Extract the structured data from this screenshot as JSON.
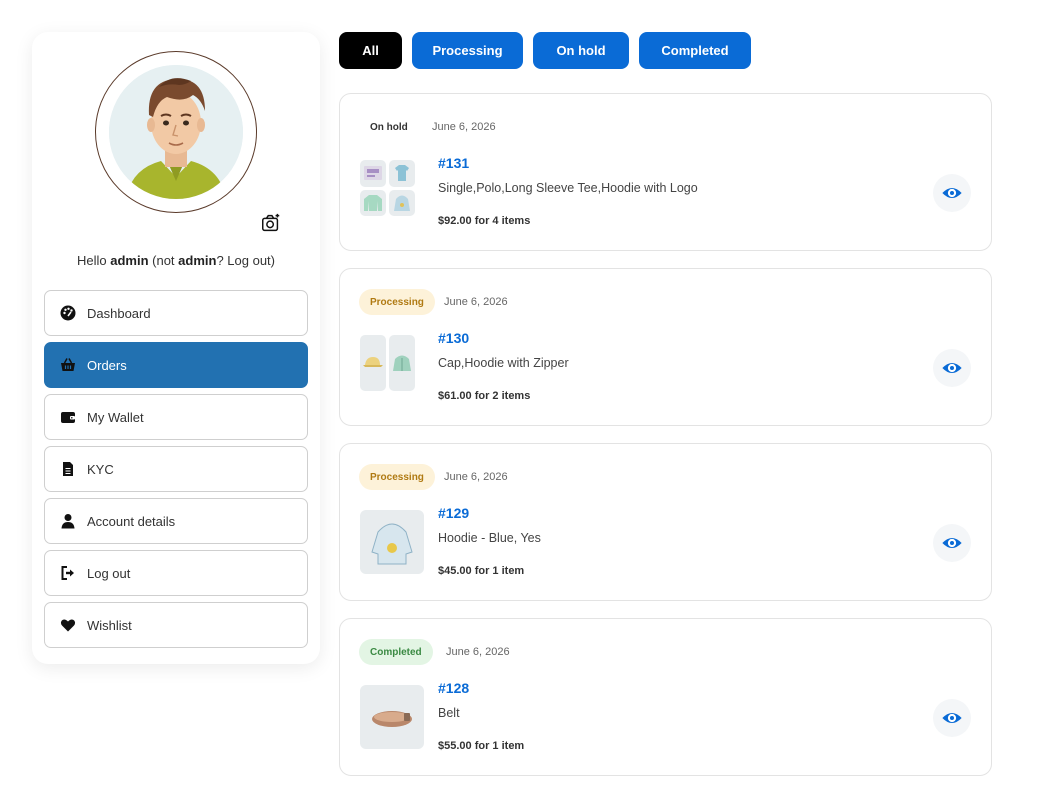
{
  "sidebar": {
    "hello_prefix": "Hello ",
    "username": "admin",
    "hello_mid": " (not ",
    "username2": "admin",
    "logout_link": "? Log out)",
    "items": [
      {
        "label": "Dashboard",
        "icon": "dashboard-icon"
      },
      {
        "label": "Orders",
        "icon": "basket-icon"
      },
      {
        "label": "My Wallet",
        "icon": "wallet-icon"
      },
      {
        "label": "KYC",
        "icon": "document-icon"
      },
      {
        "label": "Account details",
        "icon": "user-icon"
      },
      {
        "label": "Log out",
        "icon": "logout-icon"
      },
      {
        "label": "Wishlist",
        "icon": "heart-icon"
      }
    ],
    "active": "Orders"
  },
  "tabs": [
    {
      "label": "All",
      "active": true
    },
    {
      "label": "Processing",
      "active": false
    },
    {
      "label": "On hold",
      "active": false
    },
    {
      "label": "Completed",
      "active": false
    }
  ],
  "orders": [
    {
      "status": "On hold",
      "date": "June 6, 2026",
      "number": "#131",
      "items": "Single,Polo,Long Sleeve Tee,Hoodie with Logo",
      "total": "$92.00 for 4 items"
    },
    {
      "status": "Processing",
      "date": "June 6, 2026",
      "number": "#130",
      "items": "Cap,Hoodie with Zipper",
      "total": "$61.00 for 2 items"
    },
    {
      "status": "Processing",
      "date": "June 6, 2026",
      "number": "#129",
      "items": "Hoodie - Blue, Yes",
      "total": "$45.00 for 1 item"
    },
    {
      "status": "Completed",
      "date": "June 6, 2026",
      "number": "#128",
      "items": "Belt",
      "total": "$55.00 for 1 item"
    }
  ],
  "colors": {
    "accent": "#0a6bd6",
    "active_menu": "#2271b1",
    "processing_bg": "#fdf2d9",
    "completed_bg": "#e3f5e4"
  }
}
